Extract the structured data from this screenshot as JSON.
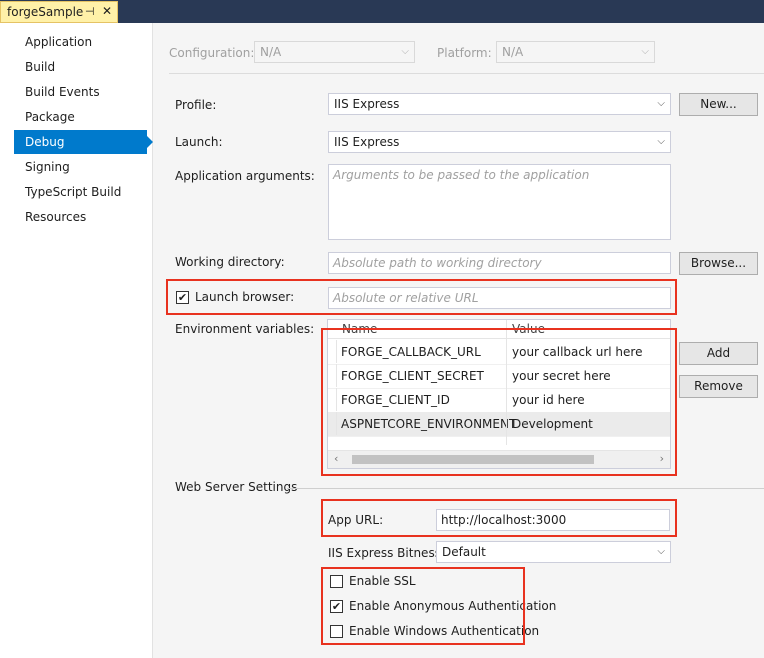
{
  "tab": {
    "title": "forgeSample",
    "pin_icon": "pin-icon",
    "close_icon": "close-icon"
  },
  "sidebar": {
    "items": [
      {
        "label": "Application"
      },
      {
        "label": "Build"
      },
      {
        "label": "Build Events"
      },
      {
        "label": "Package"
      },
      {
        "label": "Debug",
        "active": true
      },
      {
        "label": "Signing"
      },
      {
        "label": "TypeScript Build"
      },
      {
        "label": "Resources"
      }
    ]
  },
  "config": {
    "configuration_label": "Configuration:",
    "configuration_value": "N/A",
    "platform_label": "Platform:",
    "platform_value": "N/A"
  },
  "debug": {
    "profile_label": "Profile:",
    "profile_value": "IIS Express",
    "new_button": "New...",
    "launch_label": "Launch:",
    "launch_value": "IIS Express",
    "app_args_label": "Application arguments:",
    "app_args_placeholder": "Arguments to be passed to the application",
    "working_dir_label": "Working directory:",
    "working_dir_placeholder": "Absolute path to working directory",
    "browse_button": "Browse...",
    "launch_browser_label": "Launch browser:",
    "launch_browser_checked": true,
    "launch_browser_placeholder": "Absolute or relative URL",
    "env_label": "Environment variables:",
    "env_columns": [
      "Name",
      "Value"
    ],
    "env_rows": [
      {
        "name": "FORGE_CALLBACK_URL",
        "value": "your callback url here"
      },
      {
        "name": "FORGE_CLIENT_SECRET",
        "value": "your secret here"
      },
      {
        "name": "FORGE_CLIENT_ID",
        "value": "your id here"
      },
      {
        "name": "ASPNETCORE_ENVIRONMENT",
        "value": "Development"
      }
    ],
    "add_button": "Add",
    "remove_button": "Remove"
  },
  "web_server": {
    "section_label": "Web Server Settings",
    "app_url_label": "App URL:",
    "app_url_value": "http://localhost:3000",
    "bitness_label": "IIS Express Bitness:",
    "bitness_value": "Default",
    "enable_ssl_label": "Enable SSL",
    "enable_ssl_checked": false,
    "anon_auth_label": "Enable Anonymous Authentication",
    "anon_auth_checked": true,
    "win_auth_label": "Enable Windows Authentication",
    "win_auth_checked": false
  },
  "colors": {
    "accent": "#007acc",
    "highlight": "#e8321f",
    "tab": "#fff1a8",
    "titlebar": "#293955"
  }
}
